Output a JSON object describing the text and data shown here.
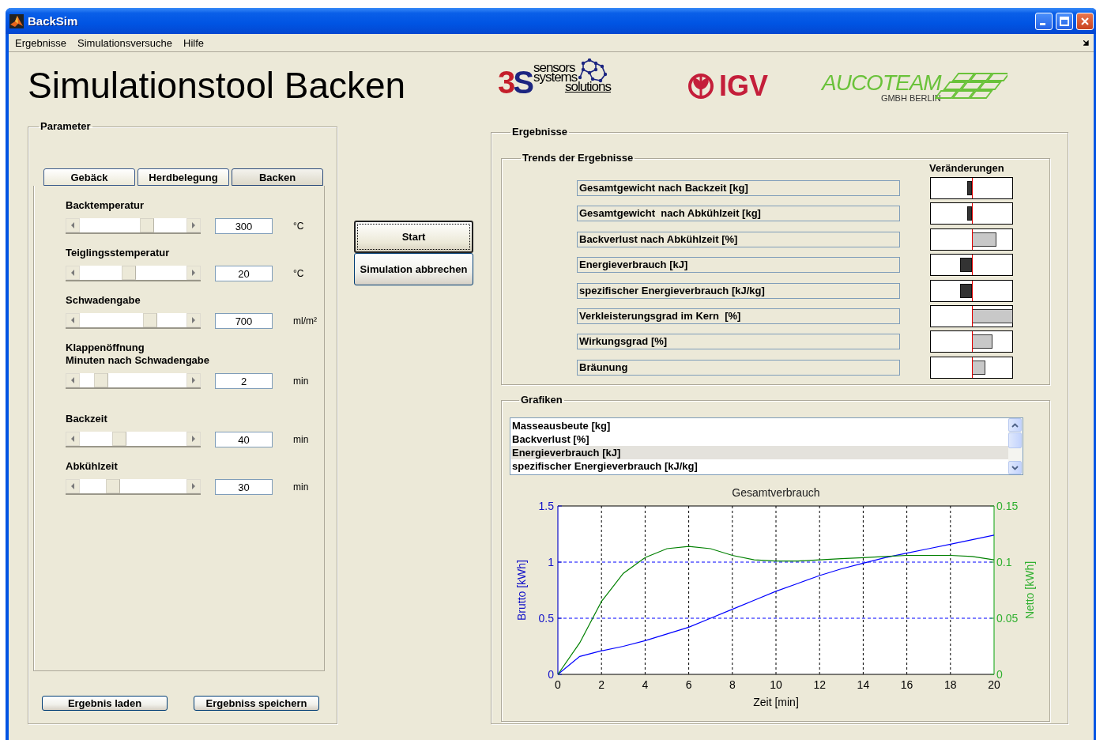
{
  "window": {
    "title": "BackSim"
  },
  "menu": [
    "Ergebnisse",
    "Simulationsversuche",
    "Hilfe"
  ],
  "heading": "Simulationstool Backen",
  "logos": [
    {
      "kind": "sensors",
      "mark": "3S",
      "lines": [
        "sensors",
        "systems",
        "solutions"
      ]
    },
    {
      "kind": "igv",
      "text": "IGV"
    },
    {
      "kind": "aucoteam",
      "text": "AUCOTEAM",
      "sub": "GMBH BERLIN"
    }
  ],
  "parameter": {
    "title": "Parameter",
    "tabs": [
      {
        "label": "Gebäck",
        "selected": false
      },
      {
        "label": "Herdbelegung",
        "selected": false
      },
      {
        "label": "Backen",
        "selected": true
      }
    ],
    "sliders": [
      {
        "label": [
          "Backtemperatur"
        ],
        "level": 0.65,
        "value": "300",
        "unit": "°C"
      },
      {
        "label": [
          "Teiglingsstemperatur"
        ],
        "level": 0.45,
        "value": "20",
        "unit": "°C"
      },
      {
        "label": [
          "Schwadengabe"
        ],
        "level": 0.68,
        "value": "700",
        "unit": "ml/m²"
      },
      {
        "label": [
          "Klappenöffnung",
          "Minuten nach Schwadengabe"
        ],
        "level": 0.15,
        "value": "2",
        "unit": "min"
      },
      {
        "label": [
          "Backzeit"
        ],
        "level": 0.35,
        "value": "40",
        "unit": "min"
      },
      {
        "label": [
          "Abkühlzeit"
        ],
        "level": 0.28,
        "value": "30",
        "unit": "min"
      }
    ],
    "buttons": [
      "Ergebnis laden",
      "Ergebniss speichern"
    ]
  },
  "actions": [
    {
      "label": "Start",
      "focused": true
    },
    {
      "label": "Simulation abbrechen",
      "focused": false
    }
  ],
  "results": {
    "title": "Ergebnisse",
    "trends": {
      "title": "Trends der Ergebnisse",
      "header": "Veränderungen",
      "rows": [
        {
          "label": "Gesamtgewicht nach Backzeit [kg]",
          "kind": "decrease"
        },
        {
          "label": "Gesamtgewicht  nach Abkühlzeit [kg]",
          "kind": "decrease"
        },
        {
          "label": "Backverlust nach Abkühlzeit [%]",
          "kind": "increase"
        },
        {
          "label": "Energieverbrauch [kJ]",
          "kind": "decrease"
        },
        {
          "label": "spezifischer Energieverbrauch [kJ/kg]",
          "kind": "decrease"
        },
        {
          "label": "Verkleisterungsgrad im Kern  [%]",
          "kind": "increase"
        },
        {
          "label": "Wirkungsgrad [%]",
          "kind": "increase"
        },
        {
          "label": "Bräunung",
          "kind": "increase"
        }
      ]
    },
    "graphics": {
      "title": "Grafiken",
      "list": [
        {
          "label": "Masseausbeute [kg]",
          "selected": false
        },
        {
          "label": "Backverlust [%]",
          "selected": false
        },
        {
          "label": "Energieverbrauch [kJ]",
          "selected": true
        },
        {
          "label": "spezifischer Energieverbrauch [kJ/kg]",
          "selected": false
        }
      ],
      "chart_data": {
        "type": "line",
        "grid": true,
        "title": "Gesamtverbrauch",
        "xlabel": "Zeit [min]",
        "ylabel": "Brutto [kWh]",
        "y2label": "Netto [kWh]",
        "x": [
          0,
          1,
          2,
          3,
          4,
          5,
          6,
          7,
          8,
          9,
          10,
          11,
          12,
          13,
          14,
          15,
          16,
          17,
          18,
          19,
          20
        ],
        "series": [
          {
            "color": "#0000ff",
            "values": [
              0,
              0.16,
              0.21,
              0.25,
              0.3,
              0.36,
              0.42,
              0.5,
              0.58,
              0.66,
              0.74,
              0.81,
              0.88,
              0.94,
              0.99,
              1.04,
              1.08,
              1.12,
              1.16,
              1.2,
              1.24
            ]
          },
          {
            "color": "#008000",
            "axis": "y2",
            "values": [
              0,
              0.028,
              0.065,
              0.09,
              0.104,
              0.112,
              0.114,
              0.112,
              0.106,
              0.102,
              0.101,
              0.101,
              0.102,
              0.103,
              0.104,
              0.105,
              0.106,
              0.106,
              0.106,
              0.105,
              0.102
            ]
          }
        ],
        "xlim": [
          0,
          20
        ],
        "ylim": [
          0,
          1.5
        ],
        "y2lim": [
          0,
          0.15
        ],
        "xticks": [
          0,
          2,
          4,
          6,
          8,
          10,
          12,
          14,
          16,
          18,
          20
        ],
        "yticks": [
          0,
          0.5,
          1,
          1.5
        ],
        "y2ticks": [
          0,
          0.05,
          0.1,
          0.15
        ]
      }
    }
  }
}
